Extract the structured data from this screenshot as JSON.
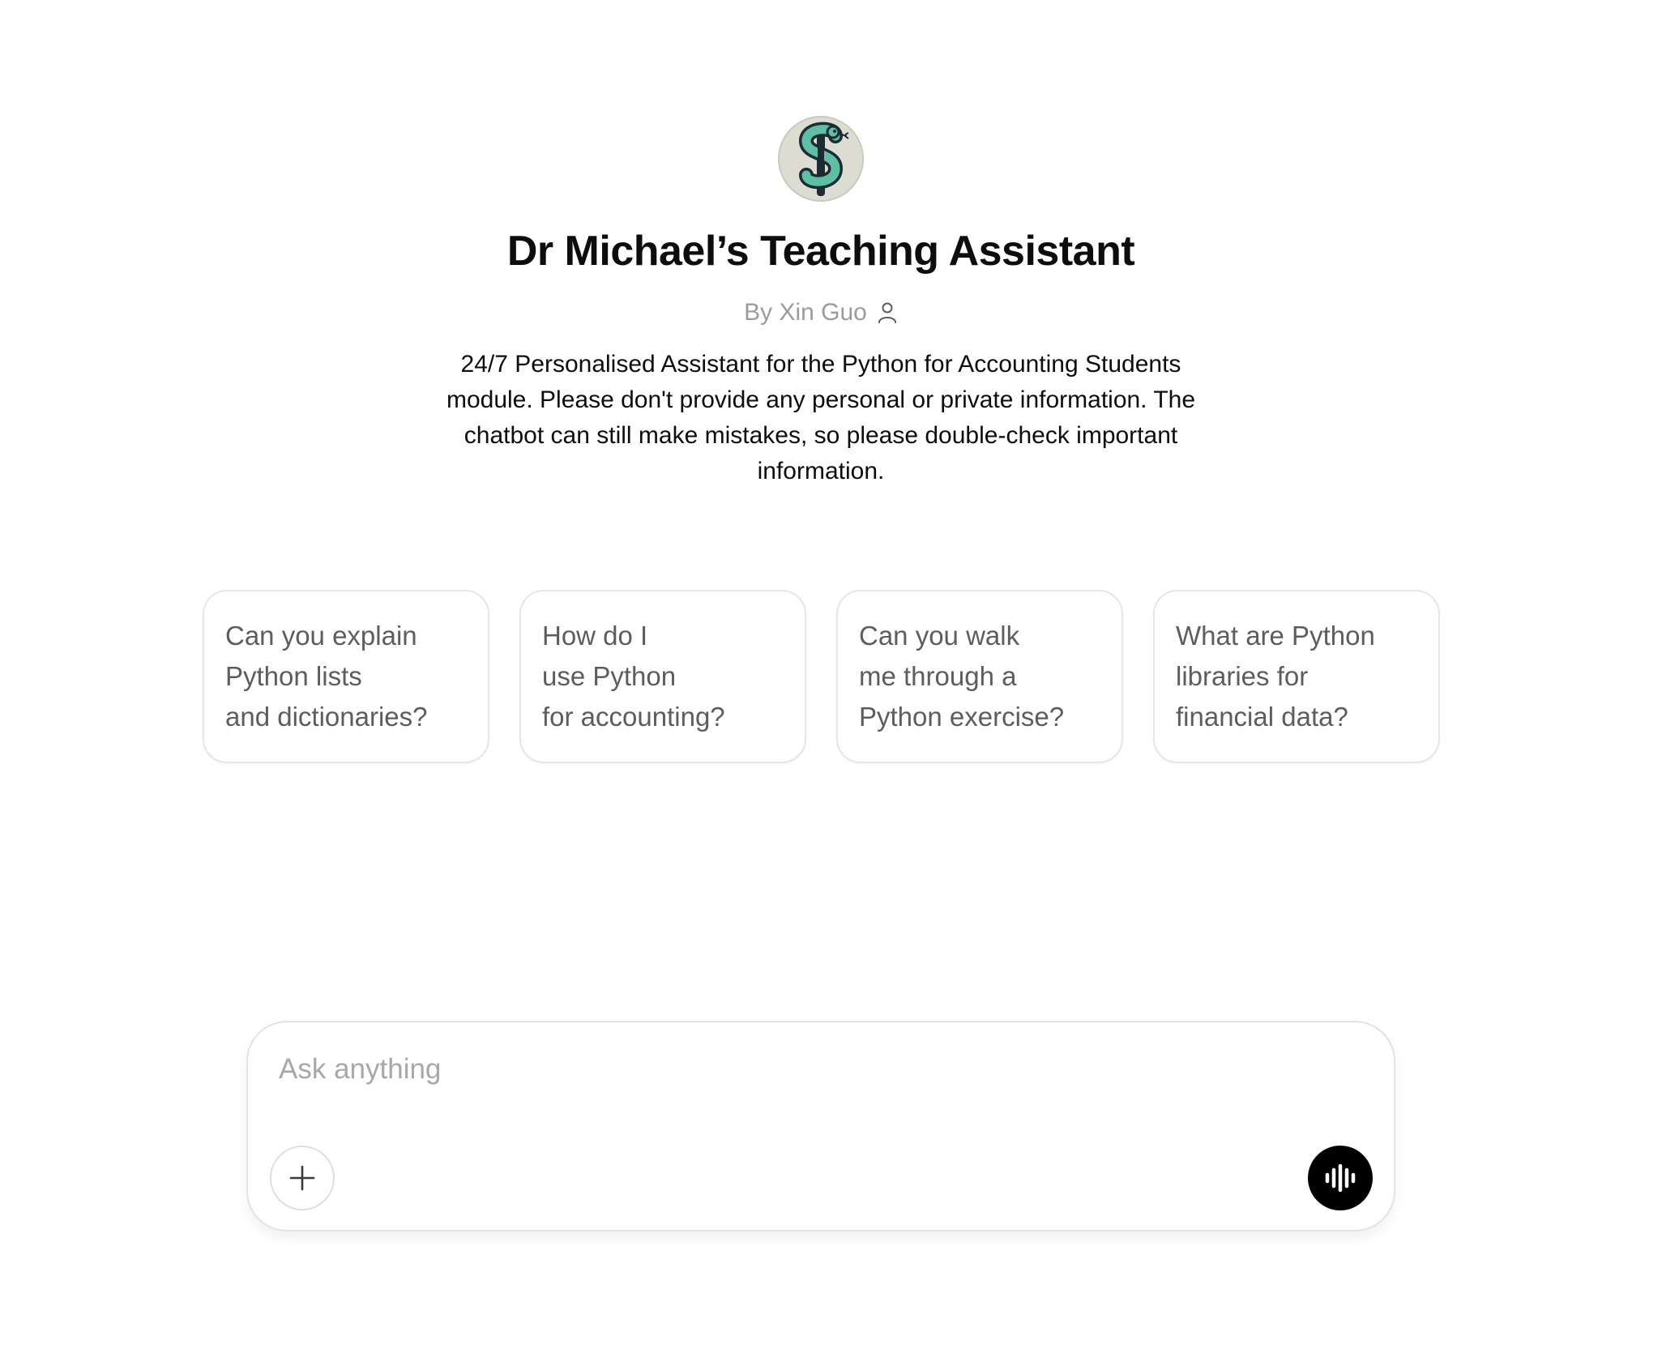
{
  "assistant": {
    "avatar_icon": "python-dollar-snake-logo",
    "title": "Dr Michael’s Teaching Assistant",
    "byline": "By Xin Guo",
    "byline_icon": "person-icon",
    "description": "24/7 Personalised Assistant for the Python for Accounting Students module. Please don't provide any personal or private information. The chatbot can still make mistakes, so please double-check important information."
  },
  "suggestions": [
    {
      "lines": [
        "Can you explain",
        "Python lists",
        "and dictionaries?"
      ]
    },
    {
      "lines": [
        "How do I",
        "use Python",
        "for accounting?"
      ]
    },
    {
      "lines": [
        "Can you walk",
        "me through a",
        "Python exercise?"
      ]
    },
    {
      "lines": [
        "What are Python",
        "libraries for",
        "financial data?"
      ]
    }
  ],
  "composer": {
    "placeholder": "Ask anything",
    "value": "",
    "attach_icon": "plus-icon",
    "voice_icon": "voice-waveform-icon"
  },
  "colors": {
    "logo_background": "#dcdcd2",
    "logo_snake": "#5fbfa3",
    "logo_outline": "#1d2b33",
    "voice_button": "#000000",
    "muted_text": "#9b9b9b",
    "card_text": "#5d5d5d"
  }
}
